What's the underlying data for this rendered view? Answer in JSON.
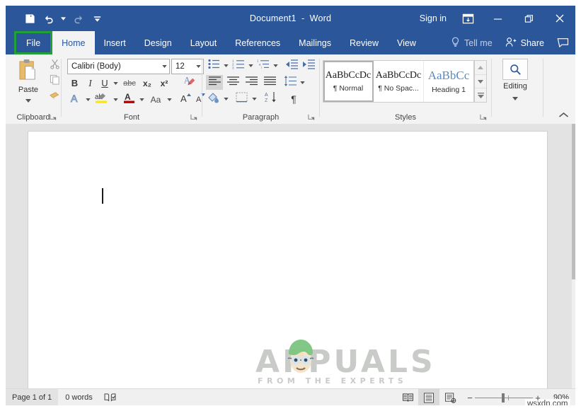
{
  "window": {
    "title_document": "Document1",
    "title_sep": "  -  ",
    "title_app": "Word",
    "sign_in": "Sign in",
    "ribbon_display_options_icon": "ribbon-display-options-icon",
    "minimize_icon": "minimize-icon",
    "restore_icon": "restore-icon",
    "close_icon": "close-icon"
  },
  "quick_access": {
    "save": "save-icon",
    "undo": "undo-icon",
    "undo_caret": "chevron-down-icon",
    "redo": "redo-icon",
    "customize": "customize-quick-access-icon"
  },
  "tabs": [
    {
      "label": "File",
      "state": "highlighted"
    },
    {
      "label": "Home",
      "state": "active"
    },
    {
      "label": "Insert",
      "state": "normal"
    },
    {
      "label": "Design",
      "state": "normal"
    },
    {
      "label": "Layout",
      "state": "normal"
    },
    {
      "label": "References",
      "state": "normal"
    },
    {
      "label": "Mailings",
      "state": "normal"
    },
    {
      "label": "Review",
      "state": "normal"
    },
    {
      "label": "View",
      "state": "normal"
    }
  ],
  "tab_right": {
    "tell_me": "Tell me",
    "tell_me_icon": "lightbulb-icon",
    "share": "Share",
    "share_icon": "person-add-icon",
    "comments_icon": "comment-icon"
  },
  "ribbon": {
    "collapse_icon": "chevron-up-icon",
    "groups": [
      {
        "name": "Clipboard",
        "label": "Clipboard",
        "launcher_icon": "dialog-launcher-icon",
        "paste_label": "Paste",
        "paste_icon": "paste-icon",
        "paste_caret": "chevron-down-icon",
        "cut_icon": "scissors-icon",
        "copy_icon": "copy-icon",
        "format_painter_icon": "format-painter-icon"
      },
      {
        "name": "Font",
        "label": "Font",
        "launcher_icon": "dialog-launcher-icon",
        "font_name_value": "Calibri (Body)",
        "font_size_value": "12",
        "bold": "B",
        "italic": "I",
        "underline": "U",
        "strikethrough": "abc",
        "subscript": "x₂",
        "superscript": "x²",
        "clear_formatting_icon": "clear-formatting-icon",
        "text_effects": "A",
        "highlight": "ab",
        "font_color": "A",
        "change_case": "Aa",
        "grow_font": "A",
        "shrink_font": "A",
        "highlight_color": "#ffe600",
        "font_color_value": "#c00000"
      },
      {
        "name": "Paragraph",
        "label": "Paragraph",
        "launcher_icon": "dialog-launcher-icon",
        "bullets_icon": "bullets-icon",
        "numbering_icon": "numbering-icon",
        "multilevel_icon": "multilevel-list-icon",
        "decrease_indent_icon": "decrease-indent-icon",
        "increase_indent_icon": "increase-indent-icon",
        "align_left_icon": "align-left-icon",
        "align_center_icon": "align-center-icon",
        "align_right_icon": "align-right-icon",
        "justify_icon": "justify-icon",
        "line_spacing_icon": "line-spacing-icon",
        "shading_icon": "shading-icon",
        "borders_icon": "borders-icon",
        "sort_icon": "sort-icon",
        "show_marks_icon": "pilcrow-icon"
      },
      {
        "name": "Styles",
        "label": "Styles",
        "launcher_icon": "dialog-launcher-icon",
        "items": [
          {
            "preview": "AaBbCcDc",
            "name": "¶ Normal",
            "selected": true,
            "kind": "body"
          },
          {
            "preview": "AaBbCcDc",
            "name": "¶ No Spac...",
            "selected": false,
            "kind": "body"
          },
          {
            "preview": "AaBbCc",
            "name": "Heading 1",
            "selected": false,
            "kind": "heading"
          }
        ],
        "scroll_up_icon": "scroll-up-icon",
        "scroll_down_icon": "scroll-down-icon",
        "more_styles_icon": "more-styles-icon"
      },
      {
        "name": "Editing",
        "label": "Editing",
        "button_label": "Editing",
        "icon": "magnifier-icon",
        "caret": "chevron-down-icon"
      }
    ]
  },
  "document": {
    "caret": "text-cursor",
    "page_background": "#ffffff",
    "workspace_background": "#e3e3e3"
  },
  "status_bar": {
    "page": "Page 1 of 1",
    "words": "0 words",
    "proofing_icon": "proofing-errors-icon",
    "read_mode_icon": "read-mode-icon",
    "print_layout_icon": "print-layout-icon",
    "web_layout_icon": "web-layout-icon",
    "zoom_out": "−",
    "zoom_in": "+",
    "zoom_value": "90%"
  },
  "watermark": {
    "main": "APPUALS",
    "sub": "FROM THE EXPERTS",
    "tag": "wsxdn.com",
    "mascot_icon": "appuals-mascot-icon"
  },
  "colors": {
    "title_bar": "#2b579a",
    "ribbon": "#f3f3f3",
    "file_highlight": "#21a038",
    "workspace": "#e3e3e3"
  }
}
